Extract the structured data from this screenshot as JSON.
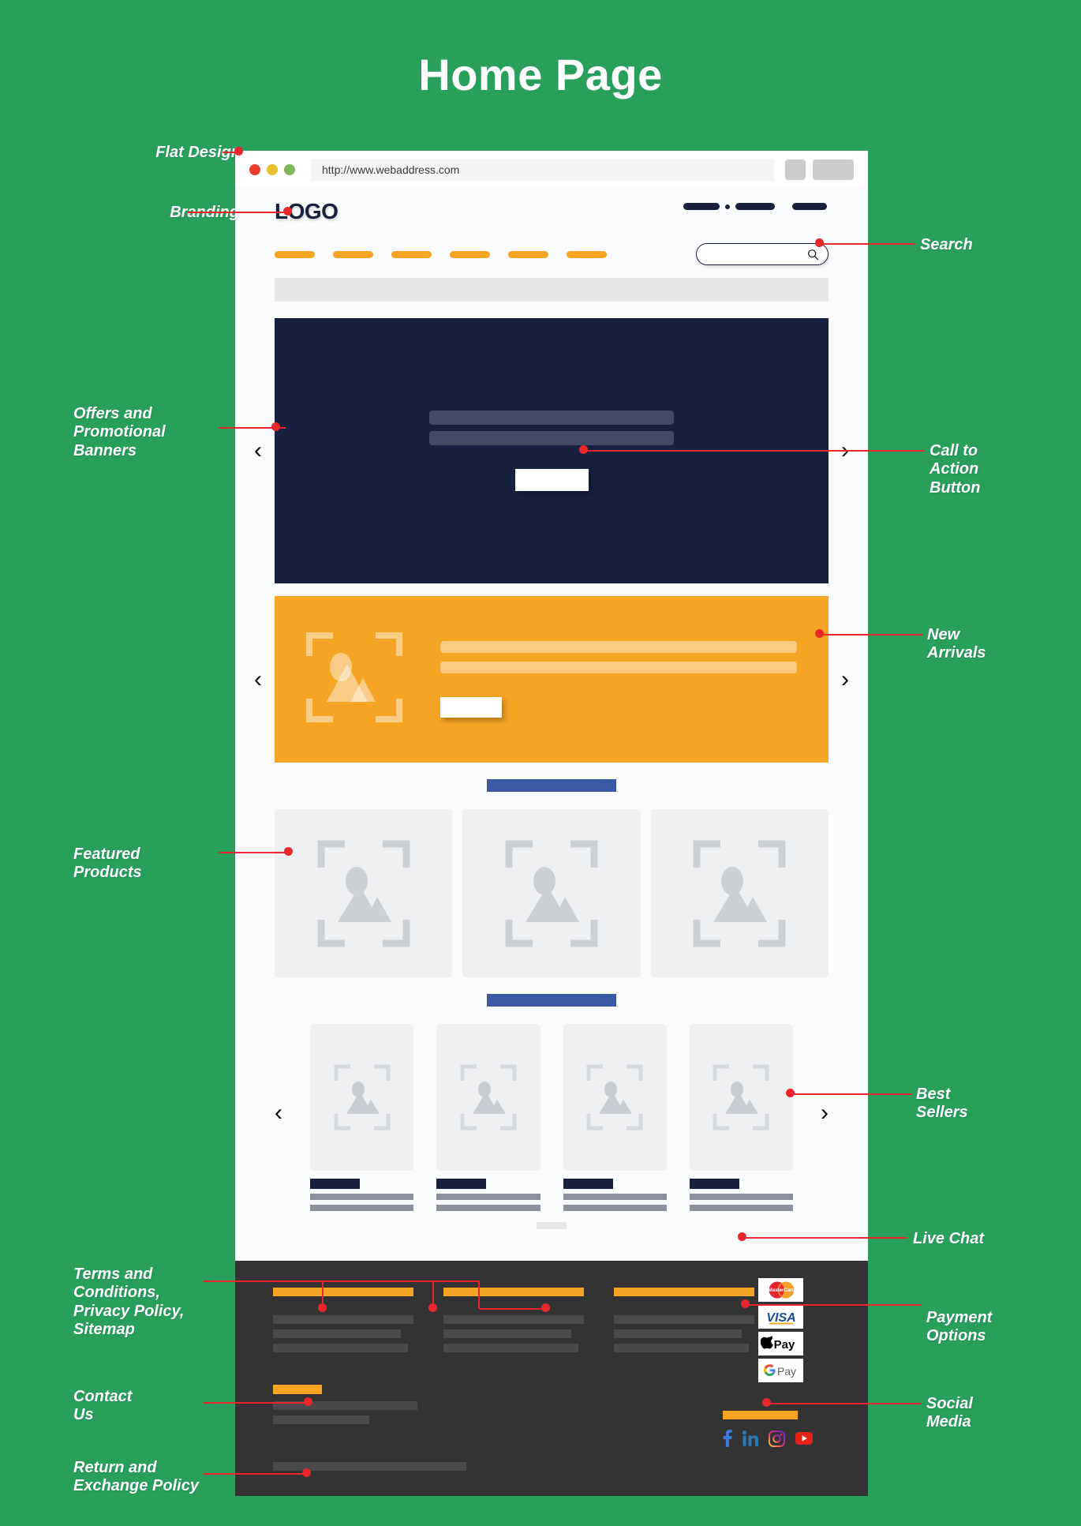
{
  "title": "Home Page",
  "browser": {
    "url": "http://www.webaddress.com",
    "dots": [
      "close-red",
      "minimize-yellow",
      "maximize-green"
    ]
  },
  "site": {
    "logo": "LOGO",
    "nav_pill_count": 6,
    "search_placeholder": "",
    "search_value": ""
  },
  "hero": {
    "cta_label": "",
    "line_count": 2
  },
  "arrivals": {
    "cta_label": "",
    "line_count": 2
  },
  "featured": {
    "card_count": 3
  },
  "best_sellers": {
    "card_count": 4
  },
  "footer": {
    "column_count": 3,
    "payments": [
      {
        "name": "mastercard",
        "label": "MasterCard"
      },
      {
        "name": "visa",
        "label": "VISA"
      },
      {
        "name": "apple-pay",
        "label": "Pay"
      },
      {
        "name": "google-pay",
        "label": "Pay"
      }
    ],
    "socials": [
      {
        "name": "facebook",
        "glyph": "f"
      },
      {
        "name": "linkedin",
        "glyph": "in"
      },
      {
        "name": "instagram",
        "glyph": ""
      },
      {
        "name": "youtube",
        "glyph": ""
      }
    ]
  },
  "annotations": {
    "flat_design": "Flat Design",
    "branding": "Branding",
    "search": "Search",
    "offers": "Offers and\nPromotional\nBanners",
    "cta": "Call to\nAction\nButton",
    "new_arrivals": "New\nArrivals",
    "featured_products": "Featured\nProducts",
    "best_sellers": "Best\nSellers",
    "live_chat": "Live Chat",
    "terms": "Terms and\nConditions,\nPrivacy Policy,\nSitemap",
    "contact": "Contact\nUs",
    "return_policy": "Return and\nExchange Policy",
    "payment": "Payment\nOptions",
    "social": "Social\nMedia"
  },
  "colors": {
    "background": "#28a05c",
    "accent_orange": "#f6a423",
    "navy": "#16213f",
    "blue_heading": "#3b5aa4",
    "leader_red": "#e8262c",
    "footer_dark": "#333333"
  }
}
